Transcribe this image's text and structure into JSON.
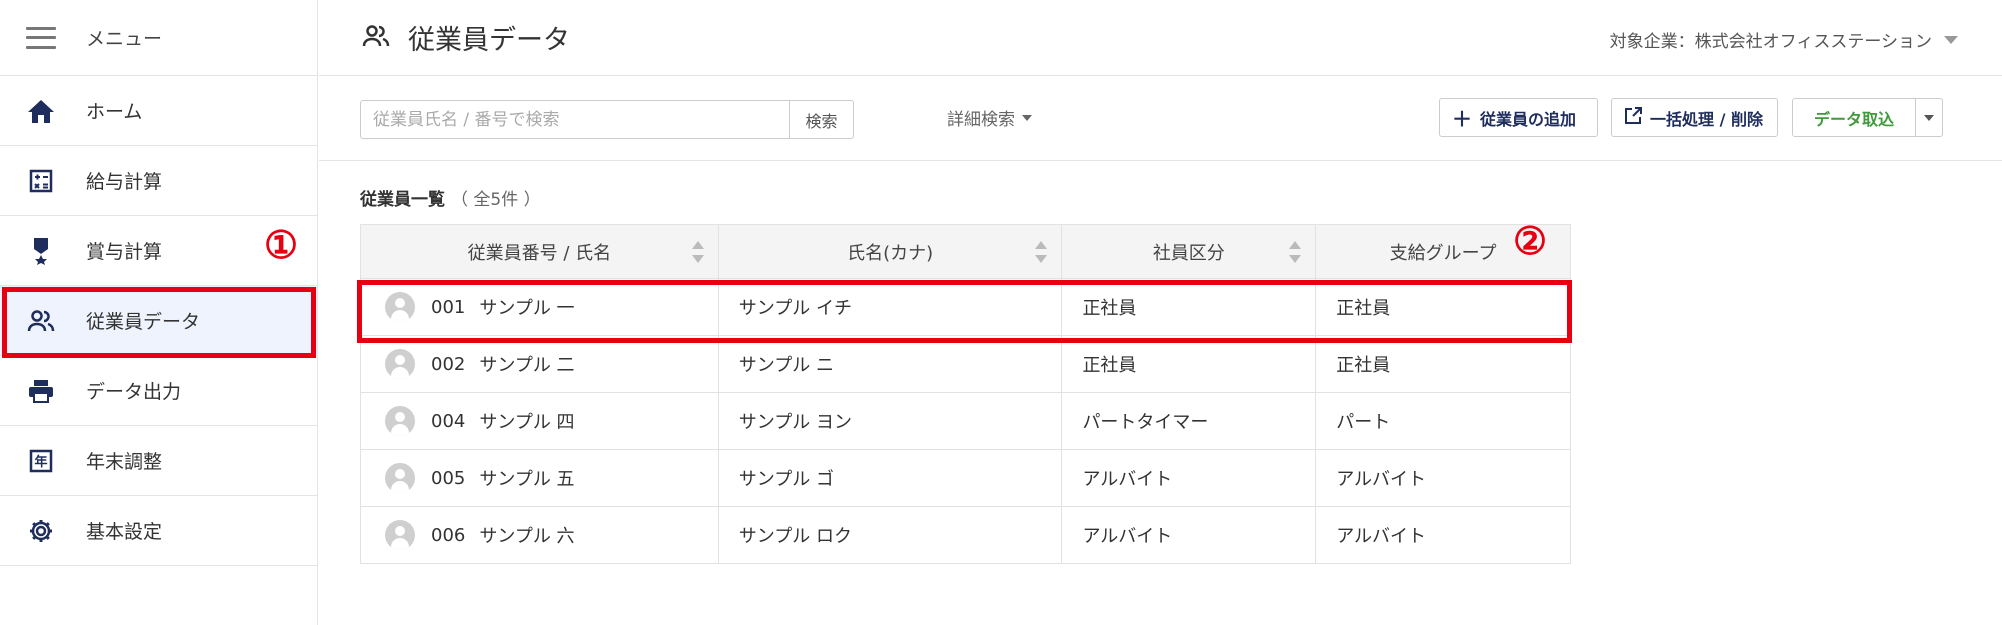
{
  "sidebar": {
    "menu_label": "メニュー",
    "items": [
      {
        "label": "ホーム",
        "icon": "home-icon"
      },
      {
        "label": "給与計算",
        "icon": "calculator-icon"
      },
      {
        "label": "賞与計算",
        "icon": "award-icon"
      },
      {
        "label": "従業員データ",
        "icon": "people-icon",
        "active": true
      },
      {
        "label": "データ出力",
        "icon": "printer-icon"
      },
      {
        "label": "年末調整",
        "icon": "year-end-icon"
      },
      {
        "label": "基本設定",
        "icon": "gear-icon"
      }
    ]
  },
  "header": {
    "title": "従業員データ",
    "company": "対象企業：株式会社オフィスステーション"
  },
  "toolbar": {
    "search_placeholder": "従業員氏名 / 番号で検索",
    "search_button": "検索",
    "advanced_search": "詳細検索",
    "add_employee": "従業員の追加",
    "bulk": "一括処理 / 削除",
    "import": "データ取込"
  },
  "list": {
    "title": "従業員一覧",
    "count": "（ 全5件 ）",
    "columns": [
      "従業員番号 / 氏名",
      "氏名(カナ)",
      "社員区分",
      "支給グループ"
    ],
    "rows": [
      {
        "number": "001",
        "name": "サンプル 一",
        "kana": "サンプル イチ",
        "type": "正社員",
        "group": "正社員"
      },
      {
        "number": "002",
        "name": "サンプル 二",
        "kana": "サンプル ニ",
        "type": "正社員",
        "group": "正社員"
      },
      {
        "number": "004",
        "name": "サンプル 四",
        "kana": "サンプル ヨン",
        "type": "パートタイマー",
        "group": "パート"
      },
      {
        "number": "005",
        "name": "サンプル 五",
        "kana": "サンプル ゴ",
        "type": "アルバイト",
        "group": "アルバイト"
      },
      {
        "number": "006",
        "name": "サンプル 六",
        "kana": "サンプル ロク",
        "type": "アルバイト",
        "group": "アルバイト"
      }
    ]
  },
  "annotations": {
    "marker1": "①",
    "marker2": "②"
  },
  "colors": {
    "accent": "#1f2d5c",
    "highlight": "#e60012",
    "import_green": "#3f9a3a",
    "active_bg": "#eef3fd"
  }
}
